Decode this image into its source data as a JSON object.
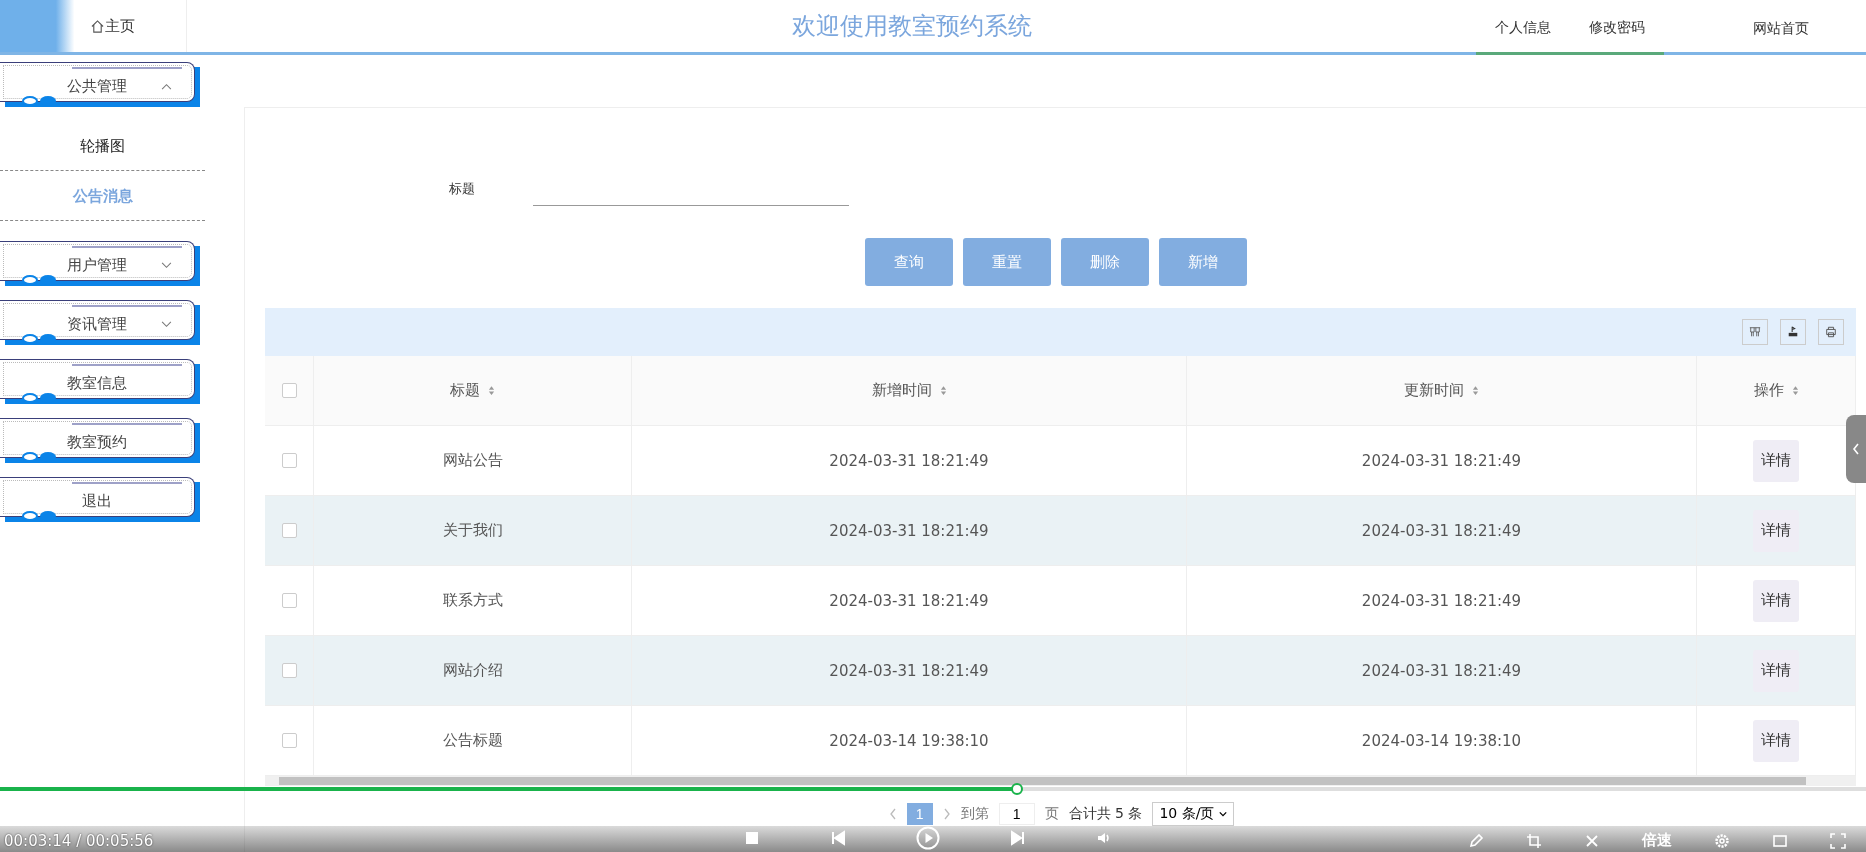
{
  "header": {
    "home": "主页",
    "title": "欢迎使用教室预约系统",
    "links": [
      {
        "label": "个人信息",
        "selected": true
      },
      {
        "label": "修改密码",
        "selected": true
      },
      {
        "label": "网站首页",
        "selected": false
      }
    ]
  },
  "sidebar": {
    "items": [
      {
        "label": "公共管理",
        "kind": "group",
        "expanded": true,
        "children": [
          {
            "label": "轮播图",
            "selected": false
          },
          {
            "label": "公告消息",
            "selected": true
          }
        ]
      },
      {
        "label": "用户管理",
        "kind": "group",
        "expanded": false
      },
      {
        "label": "资讯管理",
        "kind": "group",
        "expanded": false
      },
      {
        "label": "教室信息",
        "kind": "item"
      },
      {
        "label": "教室预约",
        "kind": "item"
      },
      {
        "label": "退出",
        "kind": "item"
      }
    ]
  },
  "search": {
    "label": "标题"
  },
  "buttons": [
    "查询",
    "重置",
    "删除",
    "新增"
  ],
  "table": {
    "header_checked": false,
    "columns": [
      "标题",
      "新增时间",
      "更新时间",
      "操作"
    ],
    "rows": [
      {
        "checked": false,
        "title": "网站公告",
        "created": "2024-03-31 18:21:49",
        "updated": "2024-03-31 18:21:49",
        "action": "详情"
      },
      {
        "checked": false,
        "title": "关于我们",
        "created": "2024-03-31 18:21:49",
        "updated": "2024-03-31 18:21:49",
        "action": "详情"
      },
      {
        "checked": false,
        "title": "联系方式",
        "created": "2024-03-31 18:21:49",
        "updated": "2024-03-31 18:21:49",
        "action": "详情"
      },
      {
        "checked": false,
        "title": "网站介绍",
        "created": "2024-03-31 18:21:49",
        "updated": "2024-03-31 18:21:49",
        "action": "详情"
      },
      {
        "checked": false,
        "title": "公告标题",
        "created": "2024-03-14 19:38:10",
        "updated": "2024-03-14 19:38:10",
        "action": "详情"
      }
    ]
  },
  "pagination": {
    "current": "1",
    "goto_label": "到第",
    "goto_value": "1",
    "page_label": "页",
    "total": "合计共 5 条",
    "page_size": "10 条/页"
  },
  "player": {
    "time": "00:03:14 / 00:05:56",
    "level": 0.545,
    "speed": "倍速"
  }
}
